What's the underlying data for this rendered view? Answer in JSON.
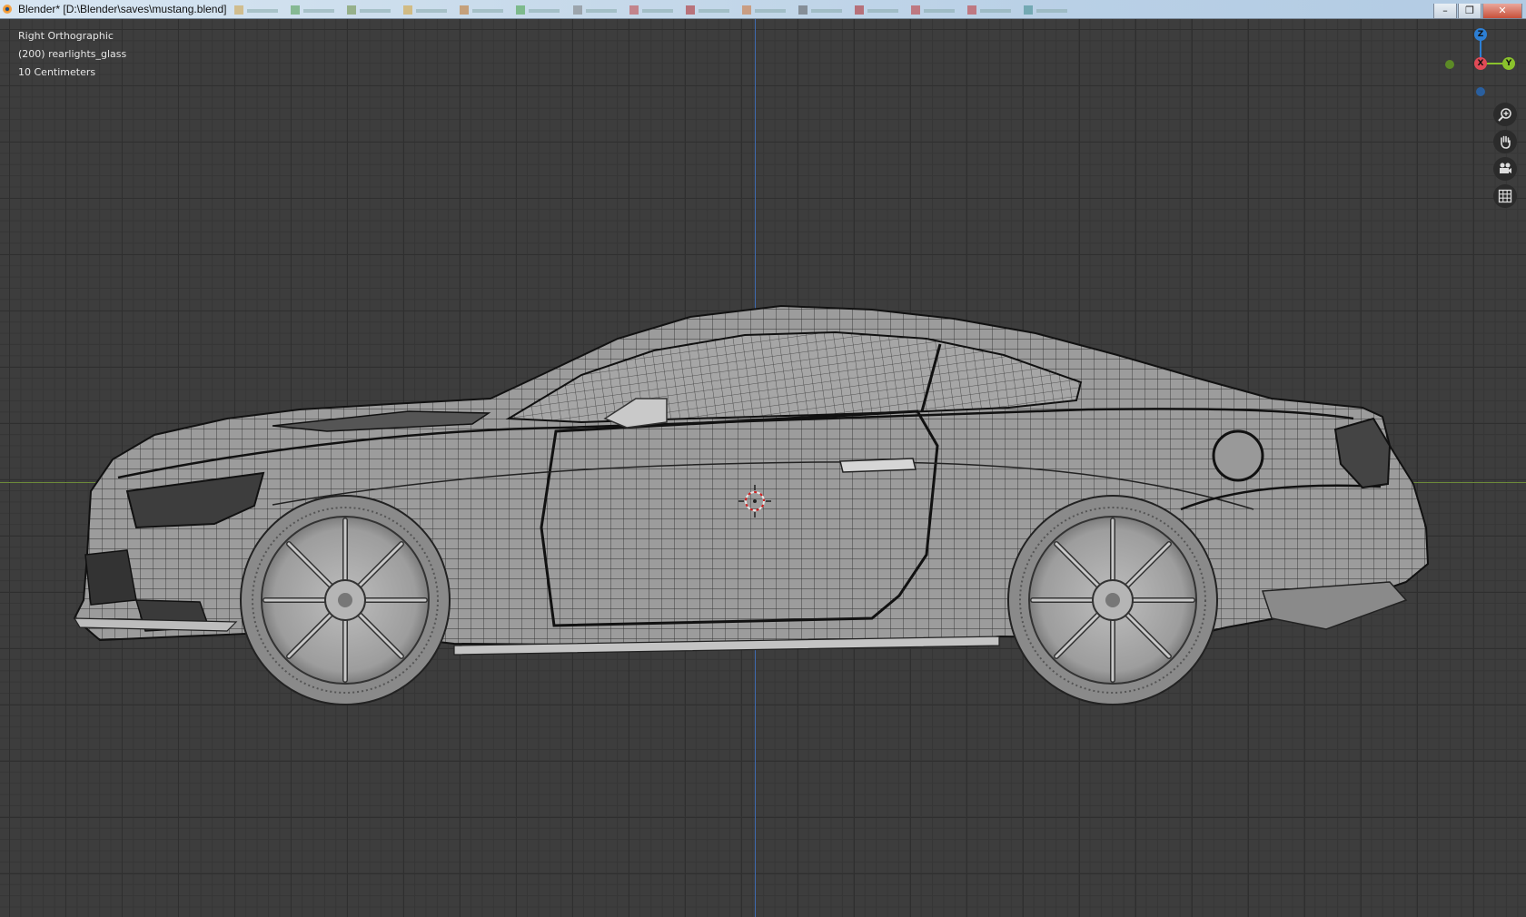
{
  "window": {
    "title": "Blender* [D:\\Blender\\saves\\mustang.blend]",
    "controls": [
      "minimize",
      "restore",
      "close"
    ]
  },
  "viewport": {
    "view_name": "Right Orthographic",
    "active_object": "(200) rearlights_glass",
    "grid_scale": "10 Centimeters",
    "background": "#3d3d3d",
    "axis_colors": {
      "x": "#6d8a3a",
      "z": "#3e6ab0"
    }
  },
  "gizmo": {
    "z_label": "Z",
    "x_label": "X",
    "y_label": "Y",
    "colors": {
      "z": "#2d7fd4",
      "x": "#e04a56",
      "y": "#8ac22c"
    }
  },
  "nav_tools": [
    {
      "icon": "zoom-icon"
    },
    {
      "icon": "hand-pan-icon"
    },
    {
      "icon": "camera-icon"
    },
    {
      "icon": "grid-ortho-icon"
    }
  ],
  "model": {
    "name": "mustang",
    "shading": "wireframe over solid",
    "body_color": "#9a9a9a"
  }
}
